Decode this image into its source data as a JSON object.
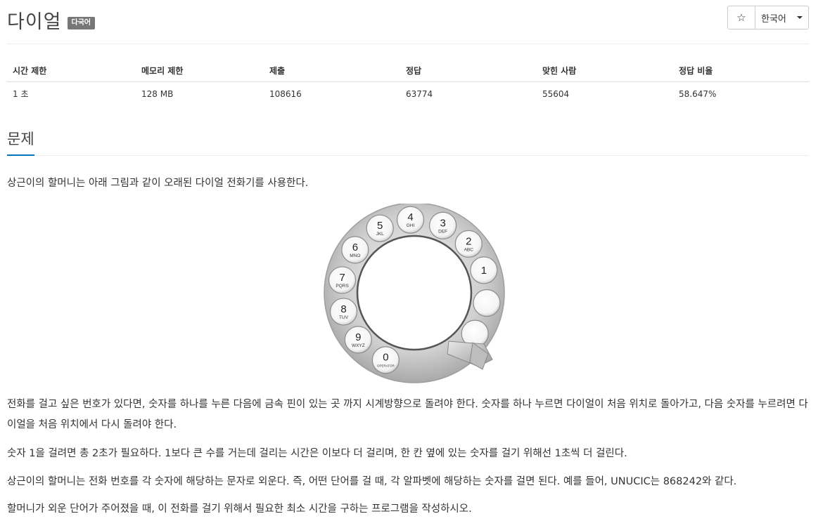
{
  "header": {
    "title": "다이얼",
    "badge": "다국어",
    "star_icon": "☆",
    "language_button": "한국어"
  },
  "stats": {
    "headers": [
      "시간 제한",
      "메모리 제한",
      "제출",
      "정답",
      "맞힌 사람",
      "정답 비율"
    ],
    "values": [
      "1 초",
      "128 MB",
      "108616",
      "63774",
      "55604",
      "58.647%"
    ]
  },
  "section": {
    "title": "문제"
  },
  "problem": {
    "intro": "상근이의 할머니는 아래 그림과 같이 오래된 다이얼 전화기를 사용한다.",
    "p1": "전화를 걸고 싶은 번호가 있다면, 숫자를 하나를 누른 다음에 금속 핀이 있는 곳 까지 시계방향으로 돌려야 한다. 숫자를 하나 누르면 다이얼이 처음 위치로 돌아가고, 다음 숫자를 누르려면 다이얼을 처음 위치에서 다시 돌려야 한다.",
    "p2": "숫자 1을 걸려면 총 2초가 필요하다. 1보다 큰 수를 거는데 걸리는 시간은 이보다 더 걸리며, 한 칸 옆에 있는 숫자를 걸기 위해선 1초씩 더 걸린다.",
    "p3": "상근이의 할머니는 전화 번호를 각 숫자에 해당하는 문자로 외운다. 즉, 어떤 단어를 걸 때, 각 알파벳에 해당하는 숫자를 걸면 된다. 예를 들어, UNUCIC는 868242와 같다.",
    "p4": "할머니가 외운 단어가 주어졌을 때, 이 전화를 걸기 위해서 필요한 최소 시간을 구하는 프로그램을 작성하시오."
  },
  "dial": {
    "holes": [
      {
        "digit": "1",
        "letters": ""
      },
      {
        "digit": "2",
        "letters": "ABC"
      },
      {
        "digit": "3",
        "letters": "DEF"
      },
      {
        "digit": "4",
        "letters": "GHI"
      },
      {
        "digit": "5",
        "letters": "JKL"
      },
      {
        "digit": "6",
        "letters": "MNO"
      },
      {
        "digit": "7",
        "letters": "PQRS"
      },
      {
        "digit": "8",
        "letters": "TUV"
      },
      {
        "digit": "9",
        "letters": "WXYZ"
      },
      {
        "digit": "0",
        "letters": "OPERATOR"
      },
      {
        "digit": "",
        "letters": ""
      },
      {
        "digit": "",
        "letters": ""
      }
    ]
  }
}
